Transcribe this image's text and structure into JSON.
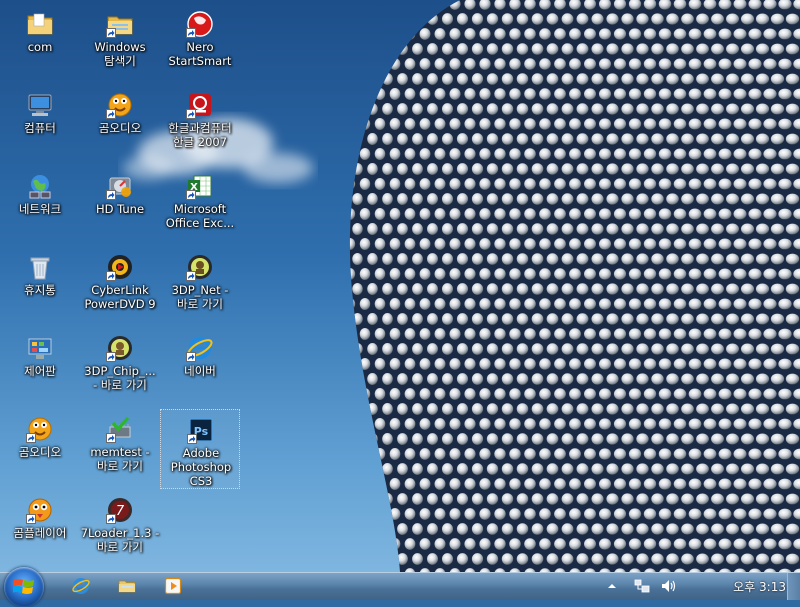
{
  "desktop_icons": [
    {
      "label": "com",
      "icon": "folder-icon",
      "shortcut": false
    },
    {
      "label": "컴퓨터",
      "icon": "computer-icon",
      "shortcut": false
    },
    {
      "label": "네트워크",
      "icon": "network-icon",
      "shortcut": false
    },
    {
      "label": "휴지통",
      "icon": "recycle-bin-icon",
      "shortcut": false
    },
    {
      "label": "제어판",
      "icon": "control-panel-icon",
      "shortcut": false
    },
    {
      "label": "곰오디오",
      "icon": "gomaudio-icon",
      "shortcut": true
    },
    {
      "label": "곰플레이어",
      "icon": "gomplayer-icon",
      "shortcut": true
    },
    {
      "label": "Windows\n탐색기",
      "icon": "explorer-folder-icon",
      "shortcut": true
    },
    {
      "label": "곰오디오",
      "icon": "gomaudio-icon",
      "shortcut": true
    },
    {
      "label": "HD Tune",
      "icon": "hdtune-icon",
      "shortcut": true
    },
    {
      "label": "CyberLink\nPowerDVD 9",
      "icon": "powerdvd-icon",
      "shortcut": true
    },
    {
      "label": "3DP_Chip_...\n- 바로 가기",
      "icon": "3dp-chip-icon",
      "shortcut": true
    },
    {
      "label": "memtest -\n바로 가기",
      "icon": "memtest-icon",
      "shortcut": true
    },
    {
      "label": "7Loader_1.3 -\n바로 가기",
      "icon": "7loader-icon",
      "shortcut": true
    },
    {
      "label": "Nero\nStartSmart",
      "icon": "nero-icon",
      "shortcut": true
    },
    {
      "label": "한글과컴퓨터\n한글 2007",
      "icon": "hangul-icon",
      "shortcut": true
    },
    {
      "label": "Microsoft\nOffice Exc...",
      "icon": "excel-icon",
      "shortcut": true
    },
    {
      "label": "3DP_Net -\n바로 가기",
      "icon": "3dp-net-icon",
      "shortcut": true
    },
    {
      "label": "네이버",
      "icon": "ie-icon",
      "shortcut": true
    },
    {
      "label": "Adobe\nPhotoshop\nCS3",
      "icon": "photoshop-icon",
      "shortcut": true,
      "selected": true
    }
  ],
  "taskbar": {
    "start_icon": "windows-logo-icon",
    "pinned": [
      {
        "icon": "ie-icon"
      },
      {
        "icon": "folder-icon"
      },
      {
        "icon": "media-player-icon"
      }
    ],
    "tray": [
      {
        "icon": "show-hidden-icons-icon"
      },
      {
        "icon": "network-icon"
      },
      {
        "icon": "volume-icon"
      }
    ],
    "clock": "오후 3:13"
  },
  "colors": {
    "sky_top": "#1d4f8a",
    "sky_bottom": "#7fb6e0",
    "taskbar": "#4a7198",
    "label_text": "#ffffff"
  }
}
